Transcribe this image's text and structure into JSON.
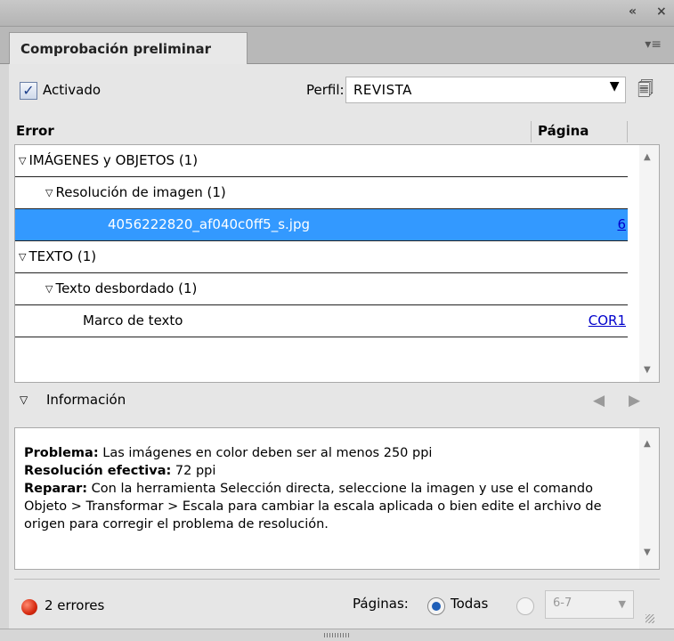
{
  "titlebar": {
    "collapse_icon": "double-chevron-left-icon",
    "close_icon": "close-icon"
  },
  "tabs": [
    {
      "label": "Comprobación preliminar"
    }
  ],
  "panel_menu_icon": "panel-menu-icon",
  "top_row": {
    "activated_label": "Activado",
    "activated_checked": true,
    "profile_label": "Perfil:",
    "profile_value": "REVISTA",
    "profile_icon": "profile-definitions-icon"
  },
  "columns": {
    "error": "Error",
    "page": "Página"
  },
  "errors_list": [
    {
      "level": 0,
      "label": "IMÁGENES y OBJETOS (1)",
      "page": ""
    },
    {
      "level": 1,
      "label": "Resolución de imagen (1)",
      "page": ""
    },
    {
      "level": 2,
      "label": "4056222820_af040c0ff5_s.jpg",
      "page": "6",
      "selected": true
    },
    {
      "level": 0,
      "label": "TEXTO (1)",
      "page": ""
    },
    {
      "level": 1,
      "label": "Texto desbordado (1)",
      "page": ""
    },
    {
      "level": 2,
      "label": "Marco de texto",
      "page": "COR1"
    }
  ],
  "info": {
    "label": "Información",
    "problem_label": "Problema:",
    "problem_text": " Las imágenes en color deben ser al menos 250 ppi",
    "resolution_label": "Resolución efectiva:",
    "resolution_text": " 72 ppi",
    "fix_label": "Reparar:",
    "fix_text": " Con la herramienta Selección directa, seleccione la imagen y use el comando Objeto > Transformar > Escala para cambiar la escala aplicada o bien edite el archivo de origen para corregir el problema de resolución."
  },
  "footer": {
    "errors_text": "2 errores",
    "pages_label": "Páginas:",
    "all_label": "Todas",
    "all_selected": true,
    "range_value": "6-7"
  },
  "colors": {
    "selection": "#3399ff",
    "error_dot": "#d62a10",
    "link": "#0000cc"
  }
}
